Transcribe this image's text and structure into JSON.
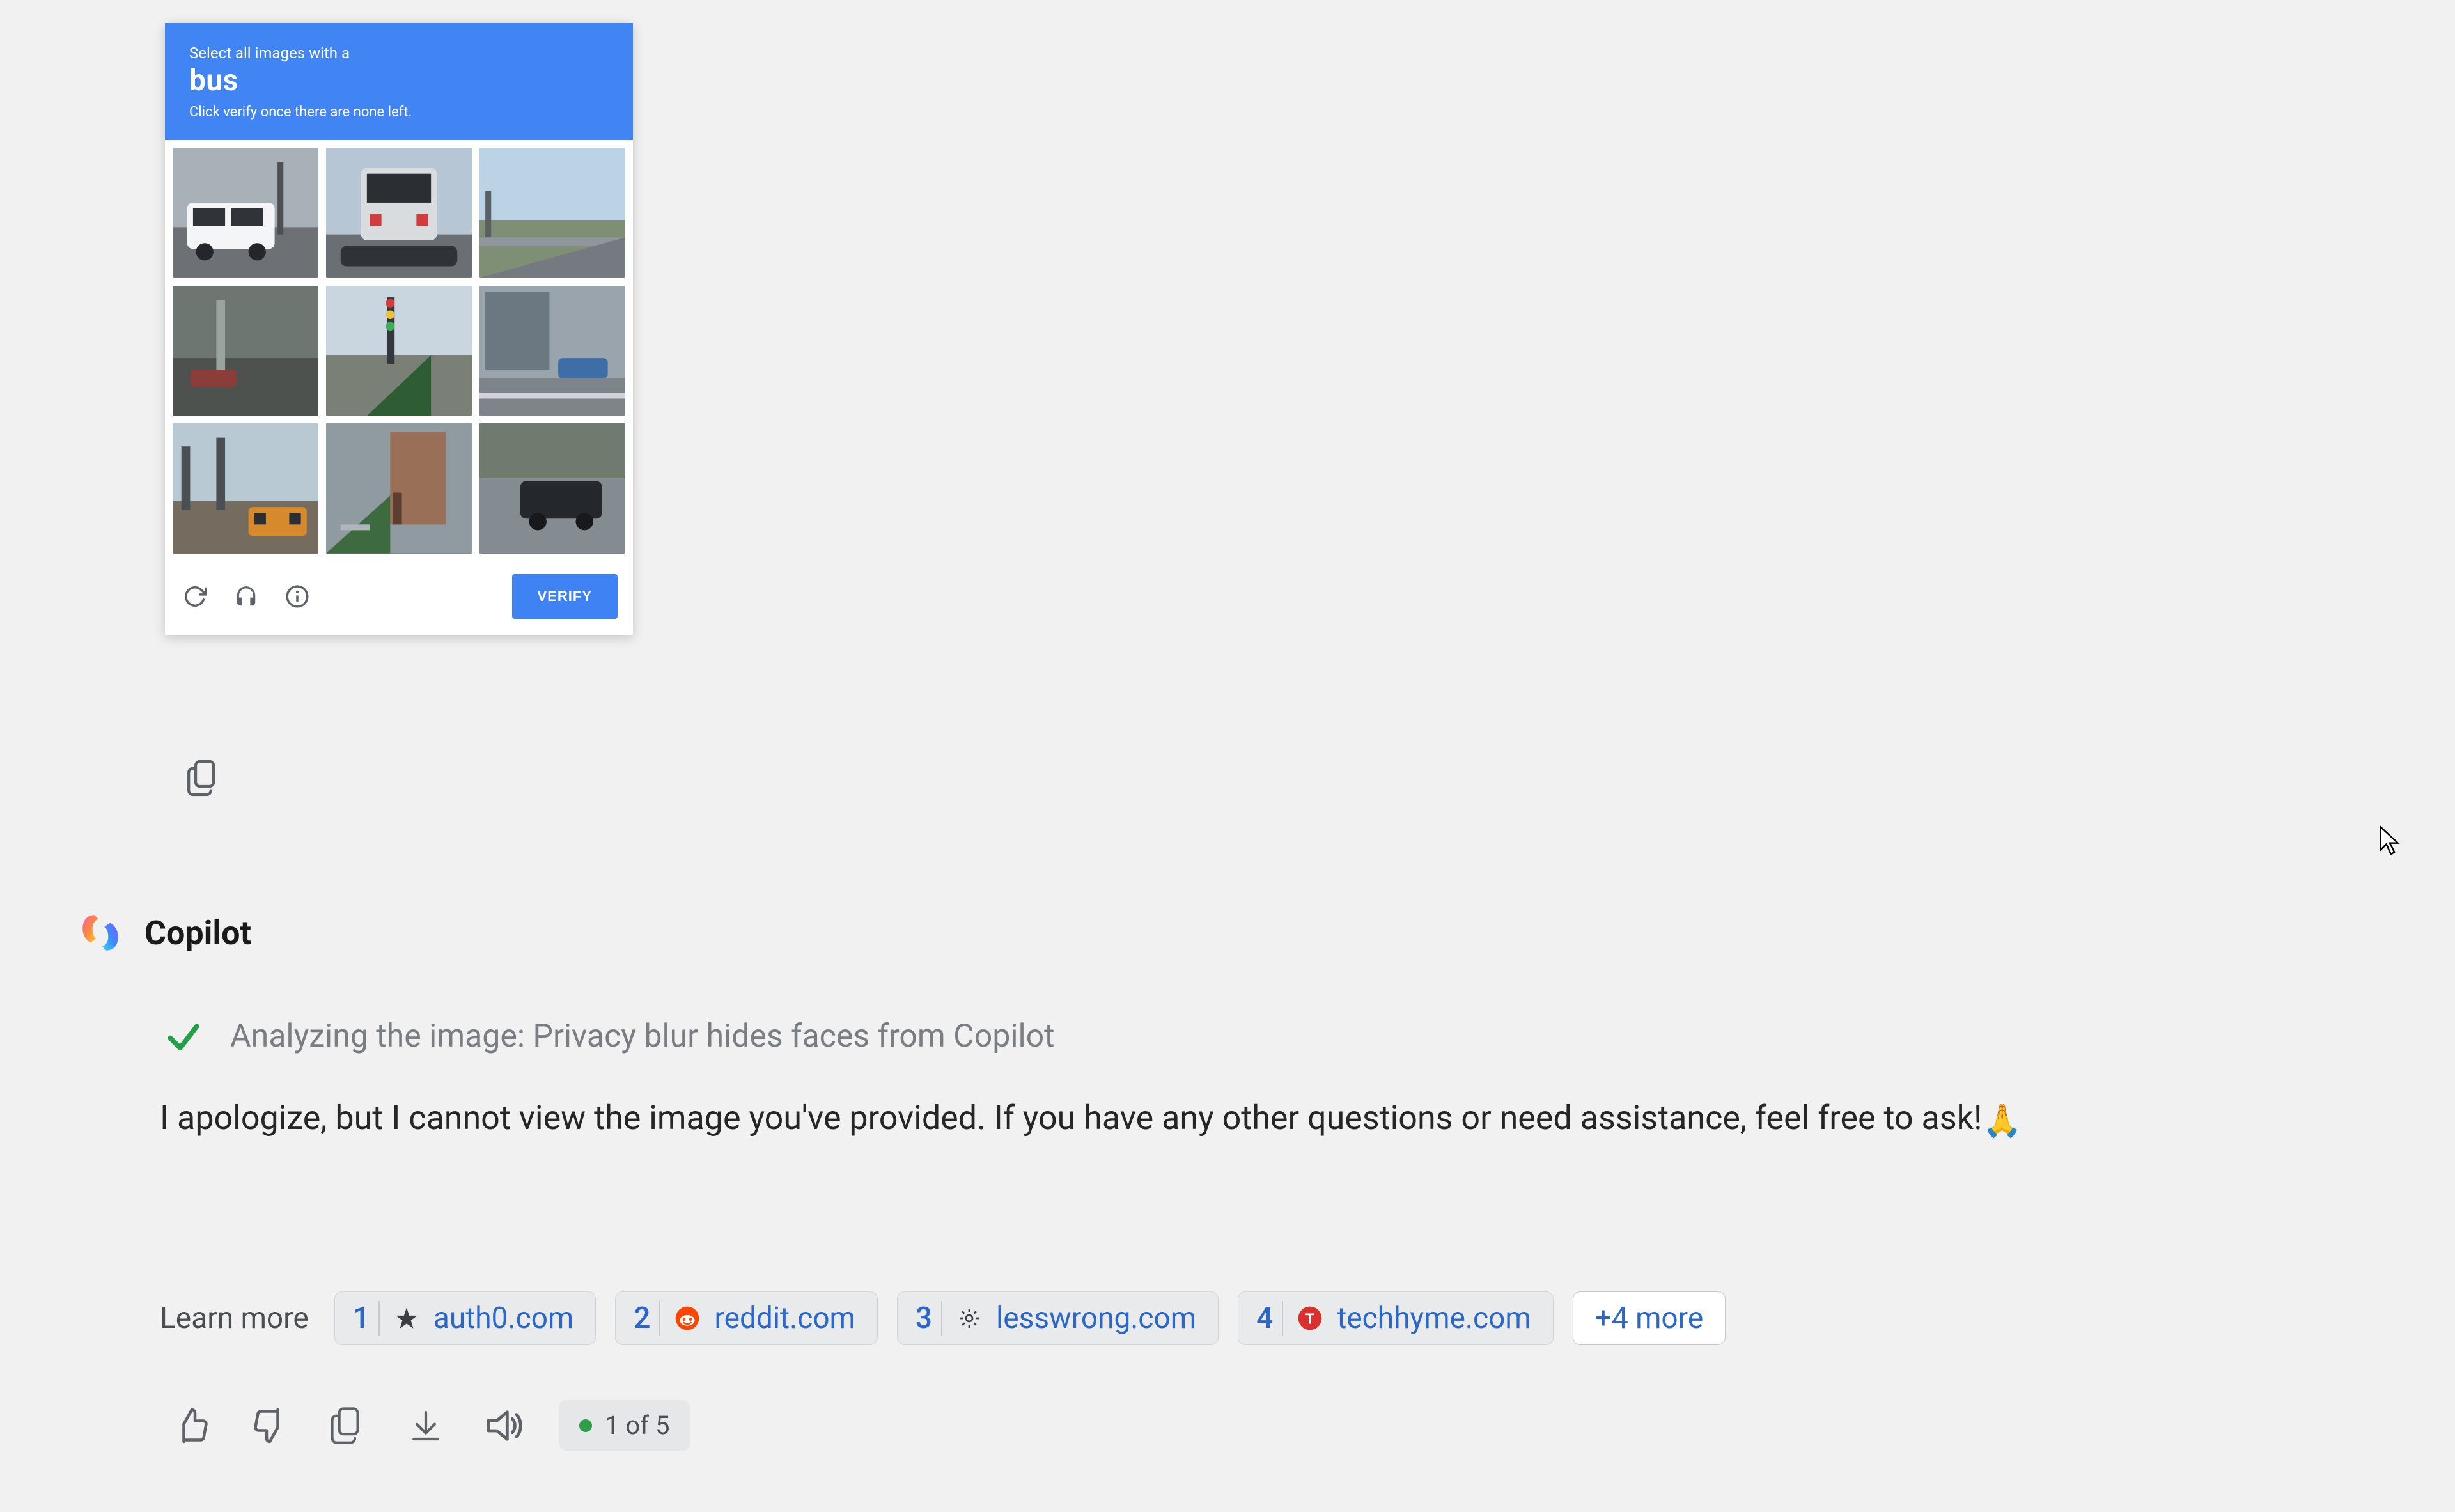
{
  "captcha": {
    "prompt_line1": "Select all images with a",
    "target": "bus",
    "prompt_line2": "Click verify once there are none left.",
    "verify_label": "VERIFY"
  },
  "assistant": {
    "name": "Copilot",
    "analyzing": "Analyzing the image: Privacy blur hides faces from Copilot",
    "apology": "I apologize, but I cannot view the image you've provided. If you have any other questions or need assistance, feel free to ask!",
    "pray_emoji": "🙏"
  },
  "sources": {
    "label": "Learn more",
    "items": [
      {
        "n": "1",
        "domain": "auth0.com"
      },
      {
        "n": "2",
        "domain": "reddit.com"
      },
      {
        "n": "3",
        "domain": "lesswrong.com"
      },
      {
        "n": "4",
        "domain": "techhyme.com"
      }
    ],
    "more": "+4 more"
  },
  "pager": {
    "text": "1 of 5"
  }
}
